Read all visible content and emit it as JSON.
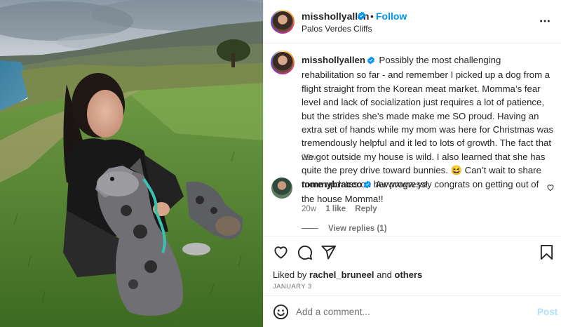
{
  "post": {
    "username": "misshollyallen",
    "follow_label": "Follow",
    "separator": "•",
    "location": "Palos Verdes Cliffs",
    "caption": "Possibly the most challenging rehabilitation so far - and remember I picked up a dog from a flight straight from the Korean meat market. Momma’s fear level and lack of socialization just requires a lot of patience, but the strides she’s made make me SO proud. Having an extra set of hands while my mom was here for Christmas was tremendously helpful and it led to lots of growth. The fact that we got outside my house is wild. I also learned that she has quite the prey drive toward bunnies. 😆 Can’t wait to share more updates on her progress!",
    "caption_time": "20w",
    "liked_by_prefix": "Liked by",
    "liked_by_user": "rachel_bruneel",
    "liked_by_and": "and",
    "liked_by_others": "others",
    "date": "JANUARY 3"
  },
  "comment": {
    "username": "tommybracco",
    "text": "Awwwww yay congrats on getting out of the house Momma!!",
    "time": "20w",
    "likes": "1 like",
    "reply_label": "Reply",
    "view_replies": "View replies (1)"
  },
  "comment_bar": {
    "placeholder": "Add a comment...",
    "post_label": "Post"
  },
  "colors": {
    "accent": "#0095f6",
    "verified": "#0095f6",
    "post_disabled": "#b2dffc"
  },
  "icons": [
    "verified-badge-icon",
    "more-options-icon",
    "heart-icon",
    "comment-icon",
    "share-icon",
    "bookmark-icon",
    "emoji-icon"
  ]
}
